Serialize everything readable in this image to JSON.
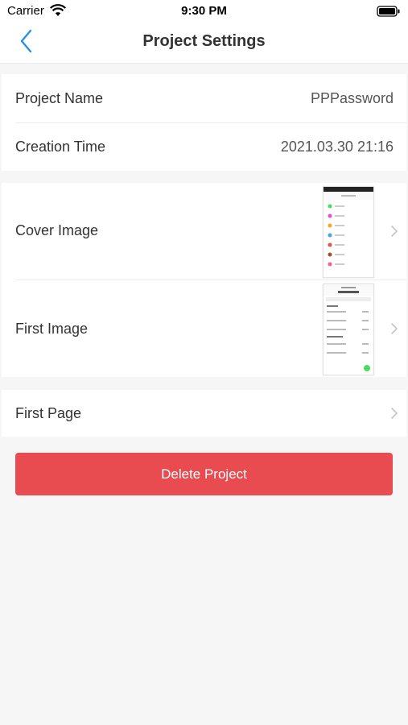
{
  "status_bar": {
    "carrier": "Carrier",
    "time": "9:30 PM"
  },
  "nav": {
    "title": "Project Settings",
    "back_icon": "chevron-left-icon",
    "accent_color": "#2a8fe6"
  },
  "info_group": {
    "project_name_label": "Project Name",
    "project_name_value": "PPPassword",
    "creation_time_label": "Creation Time",
    "creation_time_value": "2021.03.30 21:16"
  },
  "images_group": {
    "cover_image_label": "Cover Image",
    "first_image_label": "First Image"
  },
  "page_group": {
    "first_page_label": "First Page"
  },
  "delete_button": {
    "label": "Delete Project",
    "color": "#e84c50"
  }
}
